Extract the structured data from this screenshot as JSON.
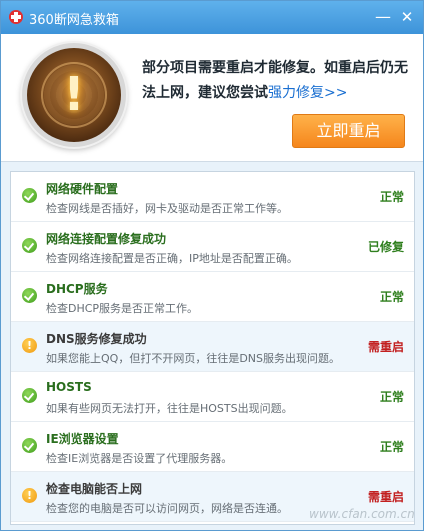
{
  "titlebar": {
    "title": "360断网急救箱",
    "minimize": "—",
    "close": "✕"
  },
  "header": {
    "message": "部分项目需要重启才能修复。如重启后仍无法上网，建议您尝试",
    "link_text": "强力修复>>",
    "restart_button": "立即重启"
  },
  "items": [
    {
      "title": "网络硬件配置",
      "desc": "检查网线是否插好，网卡及驱动是否正常工作等。",
      "status": "正常",
      "state": "ok",
      "icon": "check-icon"
    },
    {
      "title": "网络连接配置修复成功",
      "desc": "检查网络连接配置是否正确，IP地址是否配置正确。",
      "status": "已修复",
      "state": "ok",
      "icon": "check-icon"
    },
    {
      "title": "DHCP服务",
      "desc": "检查DHCP服务是否正常工作。",
      "status": "正常",
      "state": "ok",
      "icon": "check-icon"
    },
    {
      "title": "DNS服务修复成功",
      "desc": "如果您能上QQ，但打不开网页，往往是DNS服务出现问题。",
      "status": "需重启",
      "state": "warn",
      "icon": "warning-icon"
    },
    {
      "title": "HOSTS",
      "desc": "如果有些网页无法打开，往往是HOSTS出现问题。",
      "status": "正常",
      "state": "ok",
      "icon": "check-icon"
    },
    {
      "title": "IE浏览器设置",
      "desc": "检查IE浏览器是否设置了代理服务器。",
      "status": "正常",
      "state": "ok",
      "icon": "check-icon"
    },
    {
      "title": "检查电脑能否上网",
      "desc": "检查您的电脑是否可以访问网页，网络是否连通。",
      "status": "需重启",
      "state": "warn",
      "icon": "warning-icon"
    }
  ],
  "watermark": "www.cfan.com.cn",
  "colors": {
    "ok": "#2f7f1e",
    "restart": "#c21f1f",
    "accent": "#f5861c",
    "titlebar": "#3d93d9"
  }
}
